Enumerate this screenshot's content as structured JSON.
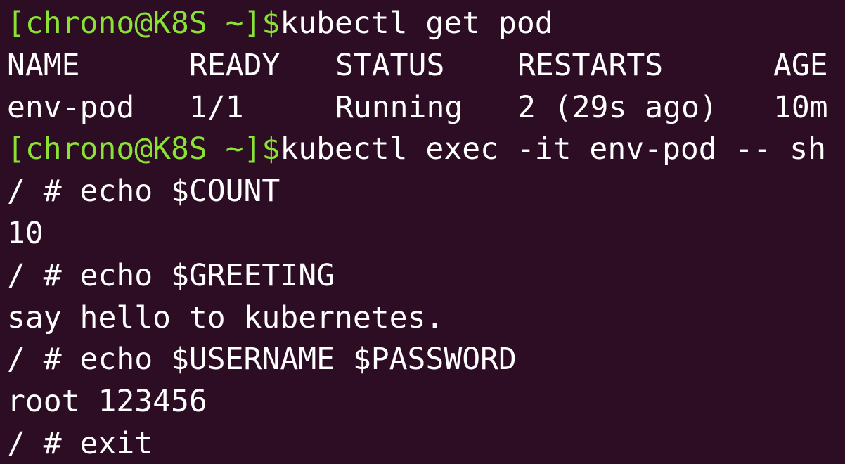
{
  "colors": {
    "background": "#2c0d23",
    "prompt": "#8ae234",
    "text": "#ffffff"
  },
  "terminal": {
    "cmd1": {
      "prompt": "[chrono@K8S ~]$",
      "command": "kubectl get pod"
    },
    "table": {
      "headers": [
        "NAME",
        "READY",
        "STATUS",
        "RESTARTS",
        "AGE"
      ],
      "rows": [
        [
          "env-pod",
          "1/1",
          "Running",
          "2 (29s ago)",
          "10m"
        ]
      ]
    },
    "cmd2": {
      "prompt": "[chrono@K8S ~]$",
      "command": "kubectl exec -it env-pod -- sh"
    },
    "shell": [
      "/ # echo $COUNT",
      "10",
      "/ # echo $GREETING",
      "say hello to kubernetes.",
      "/ # echo $USERNAME $PASSWORD",
      "root 123456",
      "/ # exit"
    ]
  }
}
